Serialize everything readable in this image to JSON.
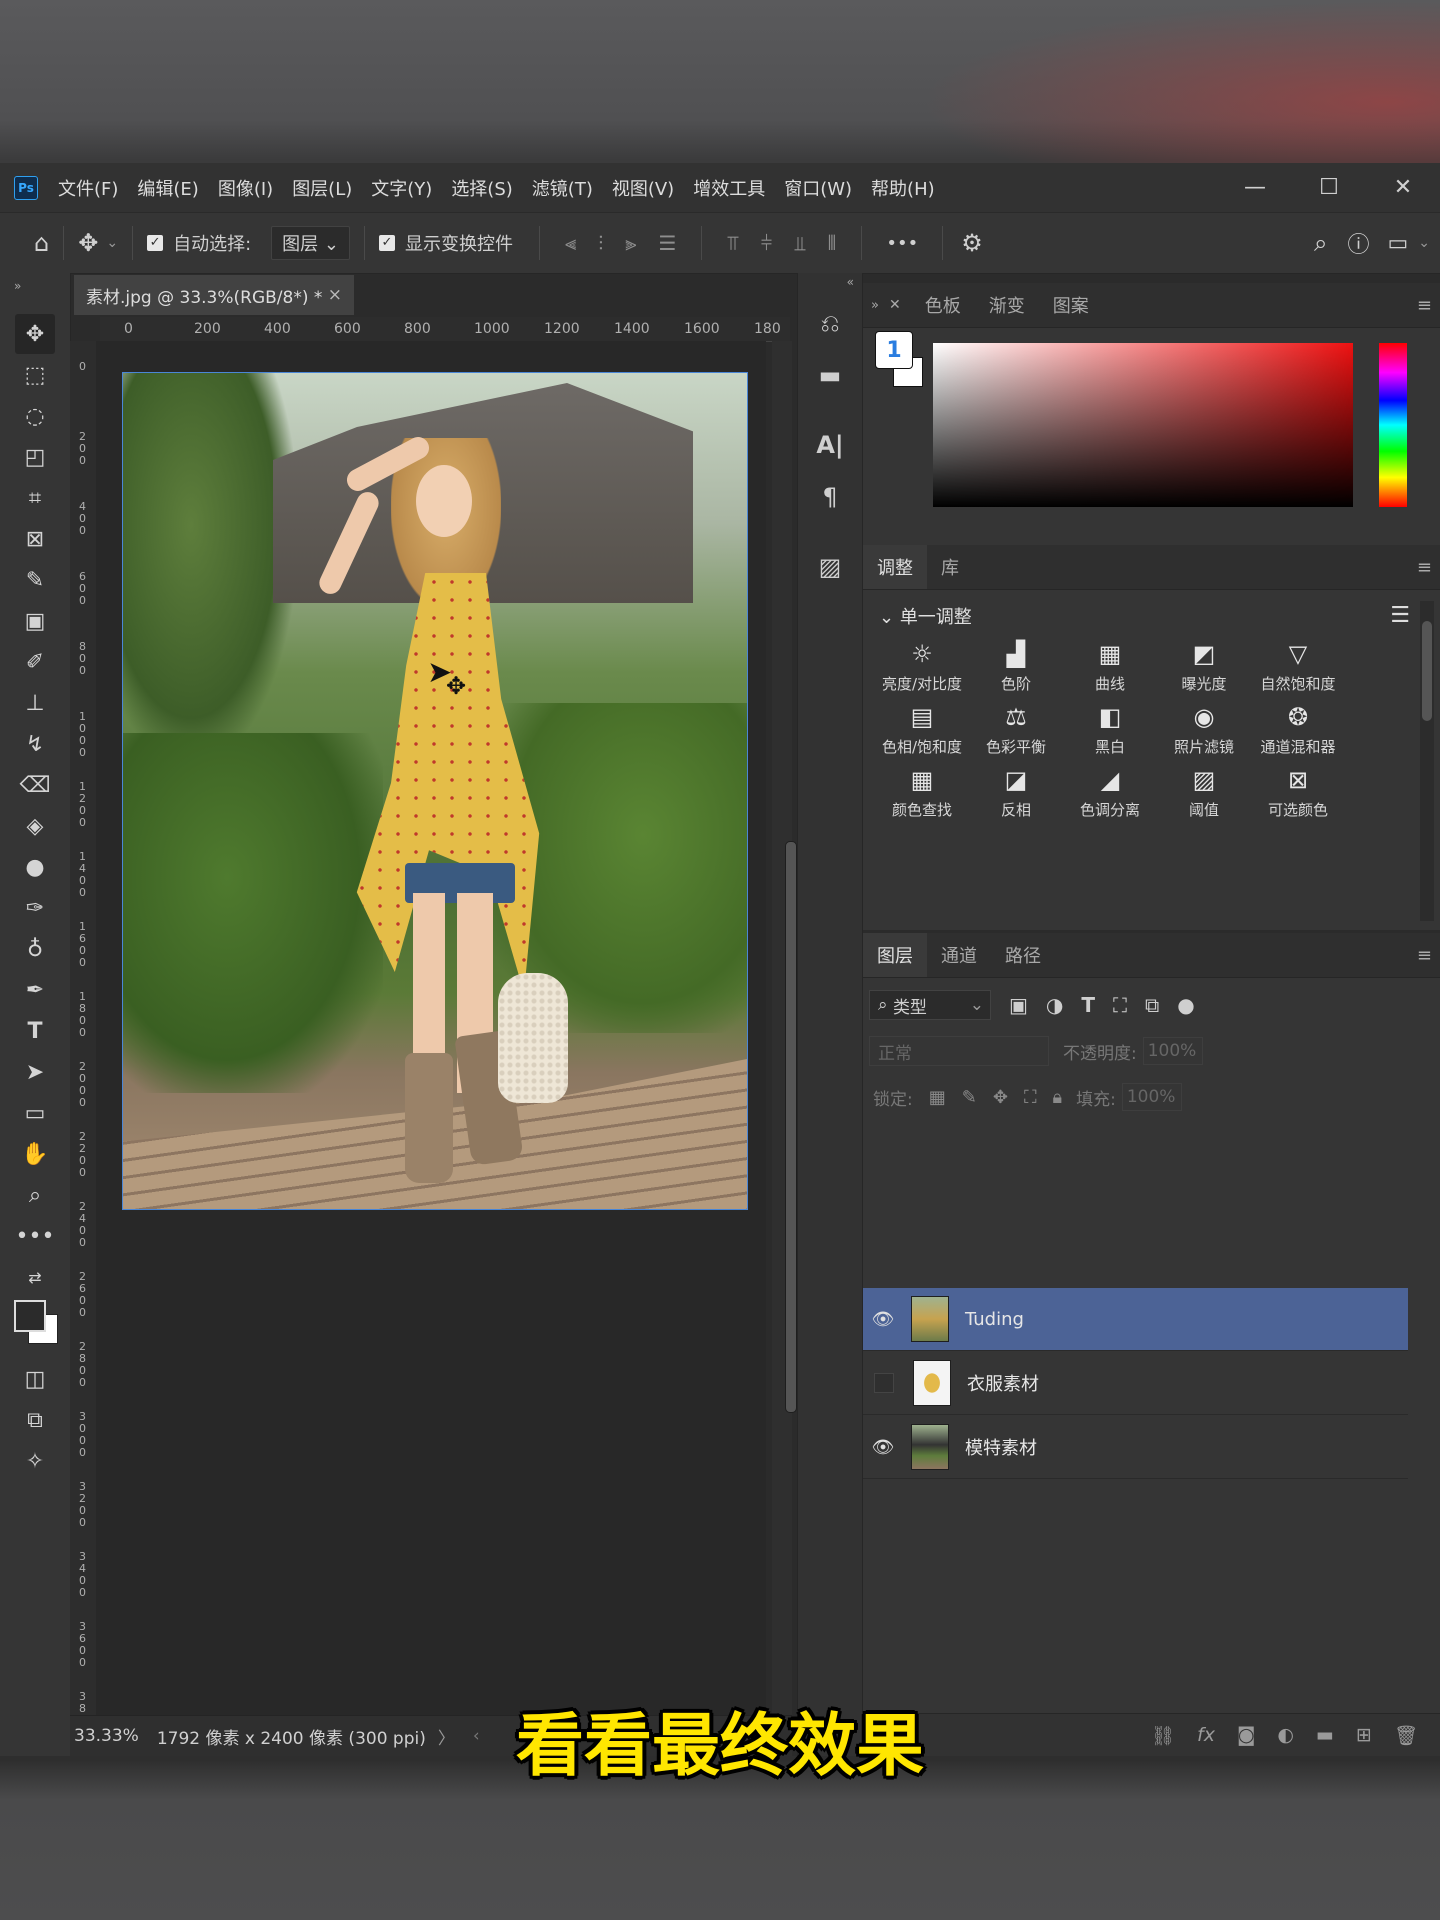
{
  "menu": [
    "文件(F)",
    "编辑(E)",
    "图像(I)",
    "图层(L)",
    "文字(Y)",
    "选择(S)",
    "滤镜(T)",
    "视图(V)",
    "增效工具",
    "窗口(W)",
    "帮助(H)"
  ],
  "app_logo": "Ps",
  "window_controls": {
    "minimize": "—",
    "maximize": "☐",
    "close": "✕"
  },
  "options_bar": {
    "auto_select_label": "自动选择:",
    "auto_select_value": "图层",
    "show_transform_label": "显示变换控件",
    "more": "•••"
  },
  "document_tab": {
    "title": "素材.jpg @ 33.3%(RGB/8*) *",
    "close": "×"
  },
  "ruler_top": [
    "0",
    "200",
    "400",
    "600",
    "800",
    "1000",
    "1200",
    "1400",
    "1600",
    "180"
  ],
  "ruler_left": [
    "0",
    "200",
    "400",
    "600",
    "800",
    "1000",
    "1200",
    "1400",
    "1600",
    "1800",
    "2000",
    "2200",
    "2400",
    "2600",
    "2800",
    "3000",
    "3200",
    "3400",
    "3600",
    "38"
  ],
  "status": {
    "zoom": "33.33%",
    "info": "1792 像素 x 2400 像素 (300 ppi)"
  },
  "color_panel": {
    "tabs": [
      "色板",
      "渐变",
      "图案"
    ],
    "swatch_icon": "1"
  },
  "adjust_panel": {
    "tabs": [
      "调整",
      "库"
    ],
    "section": "单一调整",
    "items": [
      {
        "icon": "brightness-icon",
        "glyph": "☼",
        "label": "亮度/对比度"
      },
      {
        "icon": "levels-icon",
        "glyph": "▟",
        "label": "色阶"
      },
      {
        "icon": "curves-icon",
        "glyph": "▦",
        "label": "曲线"
      },
      {
        "icon": "exposure-icon",
        "glyph": "◩",
        "label": "曝光度"
      },
      {
        "icon": "vibrance-icon",
        "glyph": "▽",
        "label": "自然饱和度"
      },
      {
        "icon": "hue-sat-icon",
        "glyph": "▤",
        "label": "色相/饱和度"
      },
      {
        "icon": "color-balance-icon",
        "glyph": "⚖",
        "label": "色彩平衡"
      },
      {
        "icon": "black-white-icon",
        "glyph": "◧",
        "label": "黑白"
      },
      {
        "icon": "photo-filter-icon",
        "glyph": "◉",
        "label": "照片滤镜"
      },
      {
        "icon": "channel-mixer-icon",
        "glyph": "❂",
        "label": "通道混和器"
      },
      {
        "icon": "color-lookup-icon",
        "glyph": "▦",
        "label": "颜色查找"
      },
      {
        "icon": "invert-icon",
        "glyph": "◪",
        "label": "反相"
      },
      {
        "icon": "posterize-icon",
        "glyph": "◢",
        "label": "色调分离"
      },
      {
        "icon": "threshold-icon",
        "glyph": "▨",
        "label": "阈值"
      },
      {
        "icon": "selective-color-icon",
        "glyph": "⊠",
        "label": "可选颜色"
      }
    ]
  },
  "layers_panel": {
    "tabs": [
      "图层",
      "通道",
      "路径"
    ],
    "kind_filter": "类型",
    "blend_mode": "正常",
    "opacity_label": "不透明度:",
    "opacity_value": "100%",
    "lock_label": "锁定:",
    "fill_label": "填充:",
    "fill_value": "100%",
    "layers": [
      {
        "name": "Tuding",
        "visible": true,
        "selected": true
      },
      {
        "name": "衣服素材",
        "visible": false,
        "selected": false
      },
      {
        "name": "模特素材",
        "visible": true,
        "selected": false
      }
    ]
  },
  "caption": "看看最终效果"
}
